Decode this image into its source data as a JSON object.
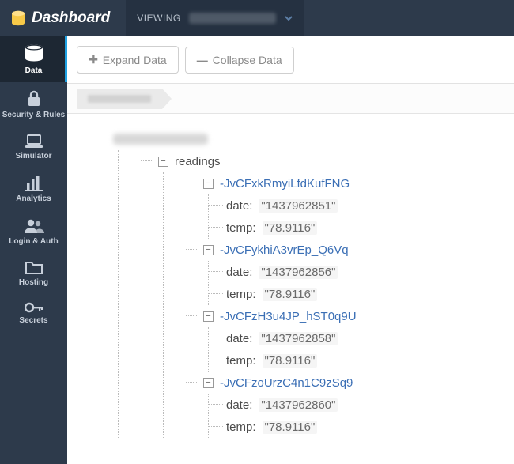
{
  "header": {
    "title": "Dashboard",
    "viewing_label": "VIEWING"
  },
  "sidebar": {
    "items": [
      {
        "id": "data",
        "label": "Data"
      },
      {
        "id": "security",
        "label": "Security & Rules"
      },
      {
        "id": "simulator",
        "label": "Simulator"
      },
      {
        "id": "analytics",
        "label": "Analytics"
      },
      {
        "id": "login",
        "label": "Login & Auth"
      },
      {
        "id": "hosting",
        "label": "Hosting"
      },
      {
        "id": "secrets",
        "label": "Secrets"
      }
    ]
  },
  "toolbar": {
    "expand_label": "Expand Data",
    "collapse_label": "Collapse Data"
  },
  "tree": {
    "node_label": "readings",
    "entries": [
      {
        "key": "-JvCFxkRmyiLfdKufFNG",
        "date_key": "date:",
        "date": "\"1437962851\"",
        "temp_key": "temp:",
        "temp": "\"78.9116\""
      },
      {
        "key": "-JvCFykhiA3vrEp_Q6Vq",
        "date_key": "date:",
        "date": "\"1437962856\"",
        "temp_key": "temp:",
        "temp": "\"78.9116\""
      },
      {
        "key": "-JvCFzH3u4JP_hST0q9U",
        "date_key": "date:",
        "date": "\"1437962858\"",
        "temp_key": "temp:",
        "temp": "\"78.9116\""
      },
      {
        "key": "-JvCFzoUrzC4n1C9zSq9",
        "date_key": "date:",
        "date": "\"1437962860\"",
        "temp_key": "temp:",
        "temp": "\"78.9116\""
      }
    ]
  }
}
